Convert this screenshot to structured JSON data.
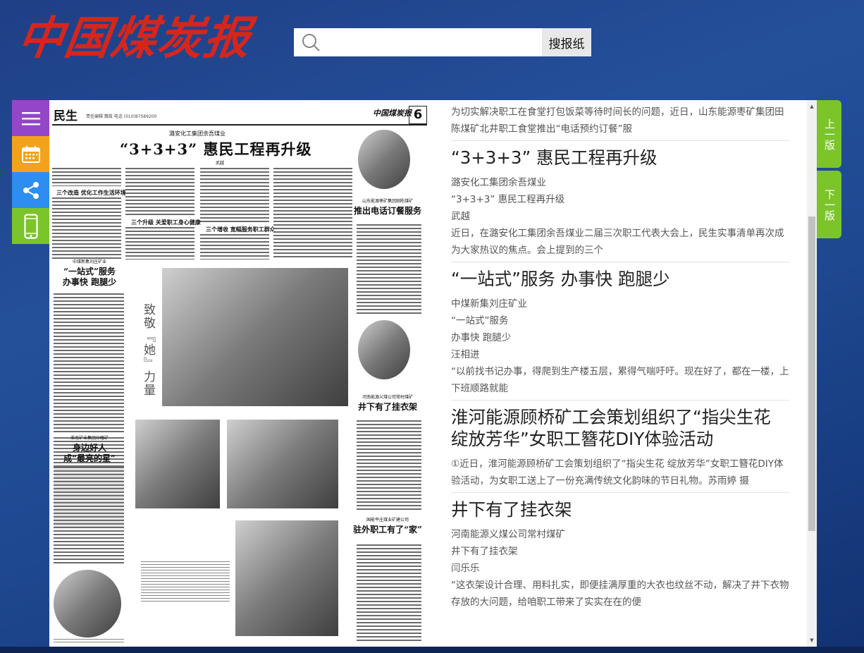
{
  "header": {
    "logo_text": "中国煤炭报",
    "search": {
      "placeholder": "",
      "value": "",
      "button_label": "搜报纸"
    }
  },
  "side_tools": [
    "menu-icon",
    "calendar-icon",
    "share-icon",
    "mobile-icon"
  ],
  "newspaper": {
    "section": "民生",
    "section_sub": "责任编辑 魏苗  电话 (010)87589200",
    "masthead": "中国煤炭报",
    "page_number": "6",
    "main_kicker": "潞安化工集团余吾煤业",
    "main_headline": "“3+3+3” 惠民工程再升级",
    "main_byline": "武越",
    "subheads": [
      "三个改造 优化工作生活环境",
      "三个升级 关爱职工身心健康",
      "三个增收 宽幅服务职工群众"
    ],
    "left_kicker": "中煤新集刘庄矿业",
    "left_title": "“一站式”服务\n办事快 跑腿少",
    "photo_vertical_title": "致敬『她』力量",
    "right_kicker_1": "山东能源枣矿集团田陈煤矿",
    "right_title_1": "推出电话订餐服务",
    "right_kicker_2": "河南能源义煤公司常村煤矿",
    "right_title_2": "井下有了挂衣架",
    "left_kicker_2": "淮北矿业集团孙疃矿",
    "left_title_2": "身边好人\n成“最亮的星”",
    "right_kicker_3": "国能平庄煤业矿建公司",
    "right_title_3": "驻外职工有了“家”"
  },
  "articles": {
    "lead_text": "为切实解决职工在食堂打包饭菜等待时间长的问题，近日，山东能源枣矿集团田陈煤矿北井职工食堂推出“电话预约订餐”服",
    "items": [
      {
        "title": "“3+3+3” 惠民工程再升级",
        "lines": [
          "潞安化工集团余吾煤业",
          "“3+3+3” 惠民工程再升级",
          "武越",
          "近日，在潞安化工集团余吾煤业二届三次职工代表大会上，民生实事清单再次成为大家热议的焦点。会上提到的三个"
        ]
      },
      {
        "title": "“一站式”服务 办事快 跑腿少",
        "lines": [
          "中煤新集刘庄矿业",
          "“一站式”服务",
          "办事快 跑腿少",
          "汪相进",
          "“以前找书记办事，得爬到生产楼五层，累得气喘吁吁。现在好了，都在一楼，上下班顺路就能"
        ]
      },
      {
        "title": "淮河能源顾桥矿工会策划组织了“指尖生花 绽放芳华”女职工簪花DIY体验活动",
        "lines": [
          "①近日，淮河能源顾桥矿工会策划组织了“指尖生花 绽放芳华”女职工簪花DIY体验活动，为女职工送上了一份充满传统文化韵味的节日礼物。苏雨婷 摄"
        ]
      },
      {
        "title": "井下有了挂衣架",
        "lines": [
          "河南能源义煤公司常村煤矿",
          "井下有了挂衣架",
          "闫乐乐",
          "“这衣架设计合理、用料扎实，即便挂满厚重的大衣也纹丝不动，解决了井下衣物存放的大问题，给咱职工带来了实实在在的便"
        ]
      }
    ]
  },
  "nav": {
    "prev_label": "上一版",
    "next_label": "下一版"
  },
  "colors": {
    "accent_green": "#7bc42a",
    "logo_red": "#d6261c",
    "menu_purple": "#9446c9",
    "calendar_orange": "#f2a31b",
    "share_blue": "#2e8df0"
  }
}
